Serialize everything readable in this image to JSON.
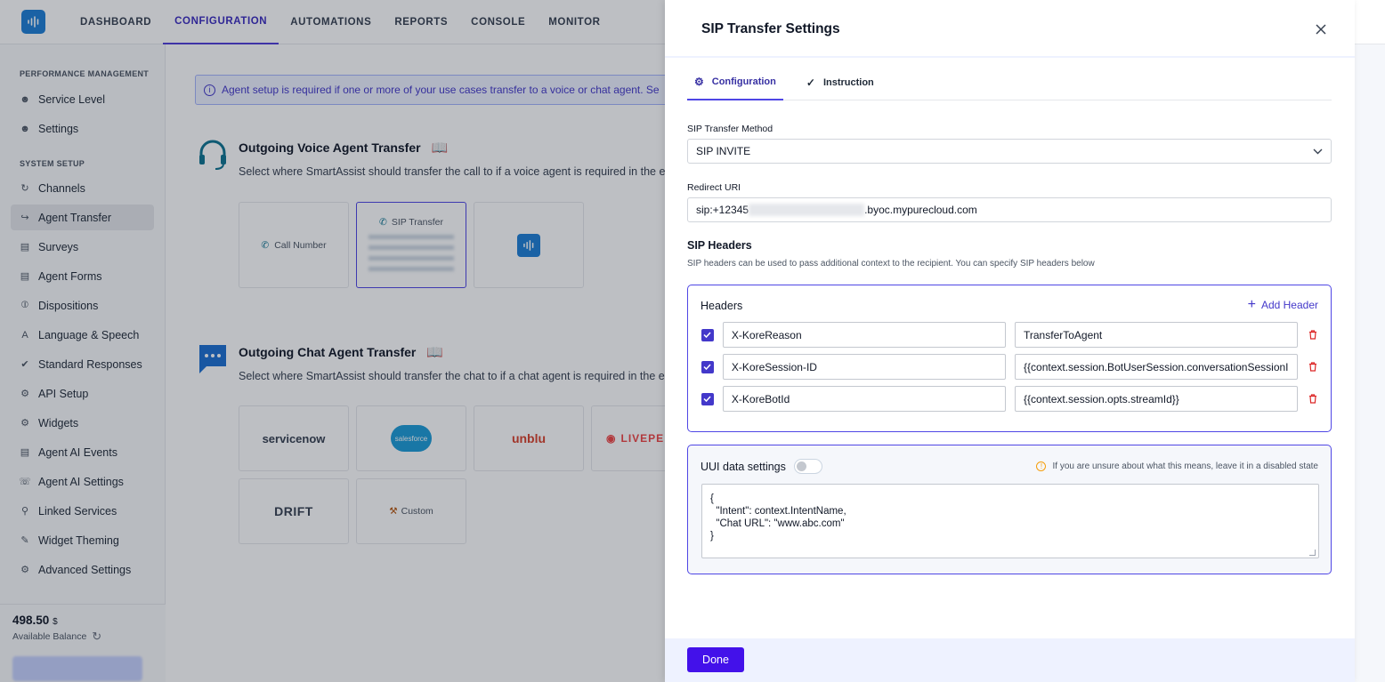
{
  "nav": {
    "items": [
      {
        "label": "DASHBOARD"
      },
      {
        "label": "CONFIGURATION"
      },
      {
        "label": "AUTOMATIONS"
      },
      {
        "label": "REPORTS"
      },
      {
        "label": "CONSOLE"
      },
      {
        "label": "MONITOR"
      }
    ],
    "active": "CONFIGURATION"
  },
  "sidebar": {
    "section1": "PERFORMANCE MANAGEMENT",
    "section1_items": [
      {
        "label": "Service Level",
        "icon": "users-icon"
      },
      {
        "label": "Settings",
        "icon": "users-icon"
      }
    ],
    "section2": "SYSTEM SETUP",
    "section2_items": [
      {
        "label": "Channels",
        "icon": "channels-icon"
      },
      {
        "label": "Agent Transfer",
        "icon": "transfer-icon"
      },
      {
        "label": "Surveys",
        "icon": "survey-icon"
      },
      {
        "label": "Agent Forms",
        "icon": "form-icon"
      },
      {
        "label": "Dispositions",
        "icon": "disposition-icon"
      },
      {
        "label": "Language & Speech",
        "icon": "language-icon"
      },
      {
        "label": "Standard Responses",
        "icon": "check-circle-icon"
      },
      {
        "label": "API Setup",
        "icon": "api-icon"
      },
      {
        "label": "Widgets",
        "icon": "gear-icon"
      },
      {
        "label": "Agent AI Events",
        "icon": "document-icon"
      },
      {
        "label": "Agent AI Settings",
        "icon": "headset-icon"
      },
      {
        "label": "Linked Services",
        "icon": "search-icon"
      },
      {
        "label": "Widget Theming",
        "icon": "brush-icon"
      },
      {
        "label": "Advanced Settings",
        "icon": "gear-icon"
      }
    ],
    "active": "Agent Transfer",
    "balance": {
      "value": "498.50",
      "currency": "$",
      "label": "Available Balance"
    }
  },
  "main": {
    "banner": "Agent setup is required if one or more of your use cases transfer to a voice or chat agent. Se",
    "voice": {
      "title": "Outgoing Voice Agent Transfer",
      "desc": "Select where SmartAssist should transfer the call to if a voice agent is required in the ex",
      "cards": [
        {
          "label": "Call Number"
        },
        {
          "label": "SIP Transfer"
        }
      ]
    },
    "chat": {
      "title": "Outgoing Chat Agent Transfer",
      "desc": "Select where SmartAssist should transfer the chat to if a chat agent is required in the ex",
      "cards": [
        {
          "label": "servicenow"
        },
        {
          "label": "salesforce"
        },
        {
          "label": "unblu"
        },
        {
          "label": "LIVEPE"
        },
        {
          "label": "DRIFT"
        },
        {
          "label": "Custom"
        }
      ]
    }
  },
  "drawer": {
    "title": "SIP Transfer Settings",
    "tabs": [
      {
        "label": "Configuration",
        "icon": "gear-icon"
      },
      {
        "label": "Instruction",
        "icon": "pin-icon"
      }
    ],
    "method_label": "SIP Transfer Method",
    "method_value": "SIP INVITE",
    "uri_label": "Redirect URI",
    "uri_prefix": "sip:+12345",
    "uri_suffix": ".byoc.mypurecloud.com",
    "headers_title": "SIP Headers",
    "headers_desc": "SIP headers can be used to pass additional context to the recipient. You can specify SIP headers below",
    "headers_box_title": "Headers",
    "add_header_label": "Add Header",
    "headers": [
      {
        "key": "X-KoreReason",
        "value": "TransferToAgent",
        "checked": true
      },
      {
        "key": "X-KoreSession-ID",
        "value": "{{context.session.BotUserSession.conversationSessionI",
        "checked": true
      },
      {
        "key": "X-KoreBotId",
        "value": "{{context.session.opts.streamId}}",
        "checked": true
      }
    ],
    "uui_title": "UUI data settings",
    "uui_enabled": false,
    "uui_hint": "If you are unsure about what this means, leave it in a disabled state",
    "uui_code": "{\n  \"Intent\": context.IntentName,\n  \"Chat URL\": \"www.abc.com\"\n}",
    "done_label": "Done"
  },
  "colors": {
    "accent": "#4f46e5",
    "primary_button": "#4311ea",
    "danger": "#dc2626"
  }
}
